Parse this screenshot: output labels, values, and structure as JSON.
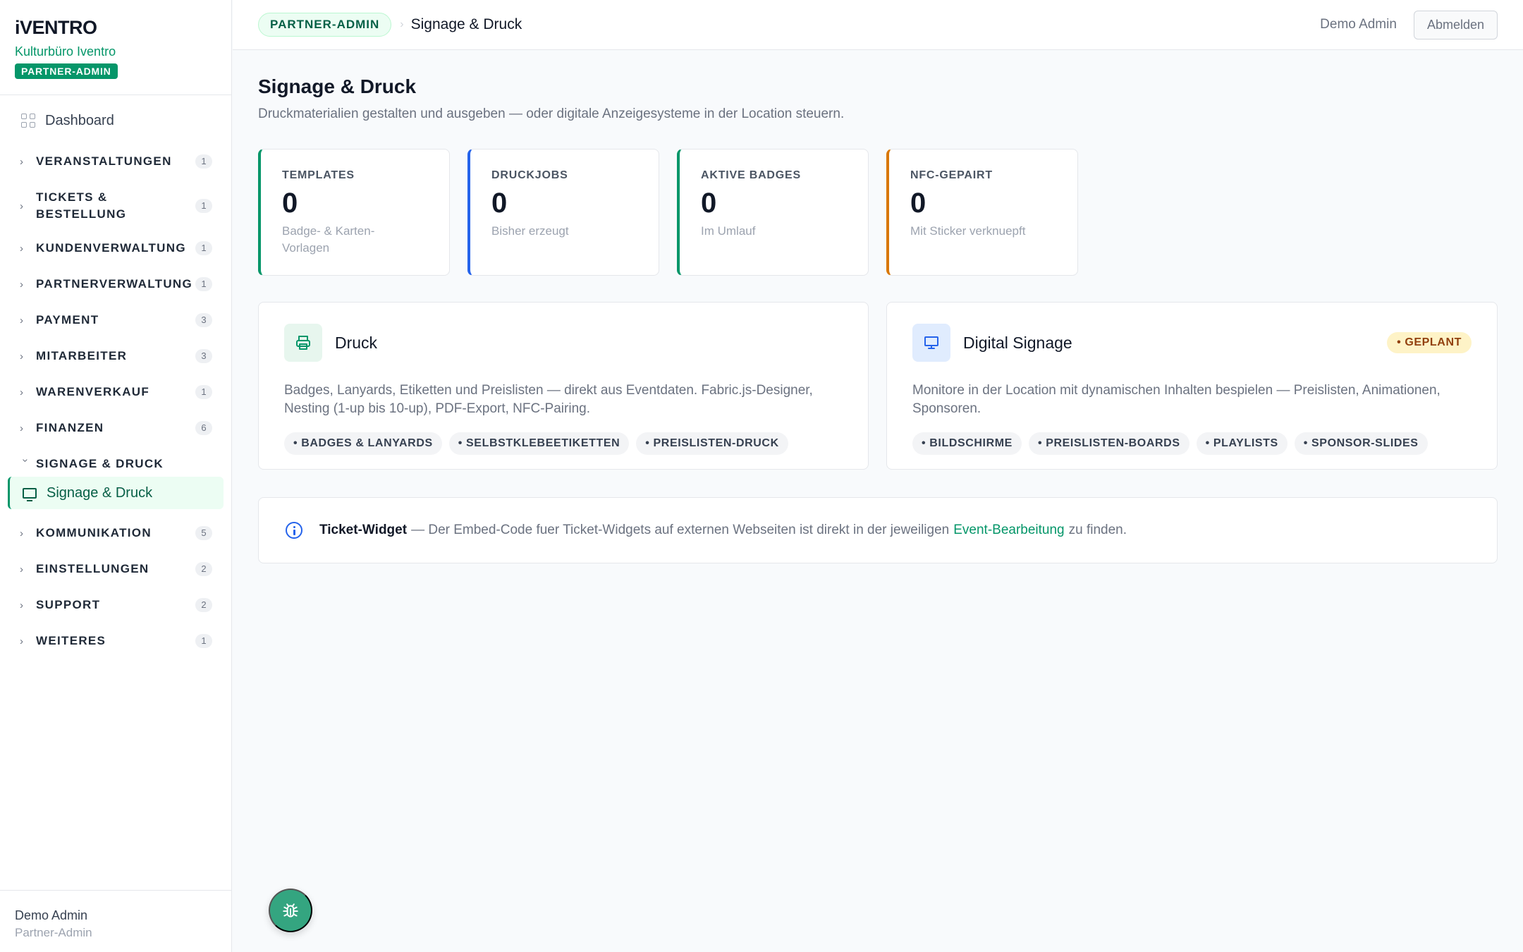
{
  "brand": {
    "logo": "iVENTRO",
    "org": "Kulturbüro Iventro",
    "role_badge": "PARTNER-ADMIN"
  },
  "sidebar": {
    "dashboard": "Dashboard",
    "groups": [
      {
        "label": "VERANSTALTUNGEN",
        "count": "1",
        "expanded": false
      },
      {
        "label": "TICKETS &\nBESTELLUNG",
        "count": "1",
        "expanded": false
      },
      {
        "label": "KUNDENVERWALTUNG",
        "count": "1",
        "expanded": false
      },
      {
        "label": "PARTNERVERWALTUNG",
        "count": "1",
        "expanded": false
      },
      {
        "label": "PAYMENT",
        "count": "3",
        "expanded": false
      },
      {
        "label": "MITARBEITER",
        "count": "3",
        "expanded": false
      },
      {
        "label": "WARENVERKAUF",
        "count": "1",
        "expanded": false
      },
      {
        "label": "FINANZEN",
        "count": "6",
        "expanded": false
      },
      {
        "label": "SIGNAGE & DRUCK",
        "count": "",
        "expanded": true
      },
      {
        "label": "KOMMUNIKATION",
        "count": "5",
        "expanded": false
      },
      {
        "label": "EINSTELLUNGEN",
        "count": "2",
        "expanded": false
      },
      {
        "label": "SUPPORT",
        "count": "2",
        "expanded": false
      },
      {
        "label": "WEITERES",
        "count": "1",
        "expanded": false
      }
    ],
    "active_item": "Signage & Druck",
    "footer": {
      "user": "Demo Admin",
      "role": "Partner-Admin"
    }
  },
  "topbar": {
    "role_pill": "PARTNER-ADMIN",
    "separator": "›",
    "title": "Signage & Druck",
    "user": "Demo Admin",
    "logout": "Abmelden"
  },
  "page": {
    "title": "Signage & Druck",
    "subtitle": "Druckmaterialien gestalten und ausgeben — oder digitale Anzeigesysteme in der Location steuern."
  },
  "stats": [
    {
      "label": "TEMPLATES",
      "value": "0",
      "desc": "Badge- & Karten-Vorlagen",
      "color": "#059669"
    },
    {
      "label": "DRUCKJOBS",
      "value": "0",
      "desc": "Bisher erzeugt",
      "color": "#2563eb"
    },
    {
      "label": "AKTIVE BADGES",
      "value": "0",
      "desc": "Im Umlauf",
      "color": "#059669"
    },
    {
      "label": "NFC-GEPAIRT",
      "value": "0",
      "desc": "Mit Sticker verknuepft",
      "color": "#d97706"
    }
  ],
  "cards": {
    "druck": {
      "title": "Druck",
      "icon": "printer-icon",
      "desc": "Badges, Lanyards, Etiketten und Preislisten — direkt aus Eventdaten. Fabric.js-Designer, Nesting (1-up bis 10-up), PDF-Export, NFC-Pairing.",
      "chips": [
        "• BADGES & LANYARDS",
        "• SELBSTKLEBEETIKETTEN",
        "• PREISLISTEN-DRUCK"
      ]
    },
    "signage": {
      "title": "Digital Signage",
      "icon": "monitor-icon",
      "badge": "• GEPLANT",
      "desc": "Monitore in der Location mit dynamischen Inhalten bespielen — Preislisten, Animationen, Sponsoren.",
      "chips": [
        "• BILDSCHIRME",
        "• PREISLISTEN-BOARDS",
        "• PLAYLISTS",
        "• SPONSOR-SLIDES"
      ]
    }
  },
  "info": {
    "title": "Ticket-Widget",
    "text_before": "— Der Embed-Code fuer Ticket-Widgets auf externen Webseiten ist direkt in der jeweiligen",
    "link": "Event-Bearbeitung",
    "text_after": "zu finden."
  },
  "colors": {
    "accent": "#059669",
    "blue": "#2563eb",
    "amber": "#d97706"
  }
}
